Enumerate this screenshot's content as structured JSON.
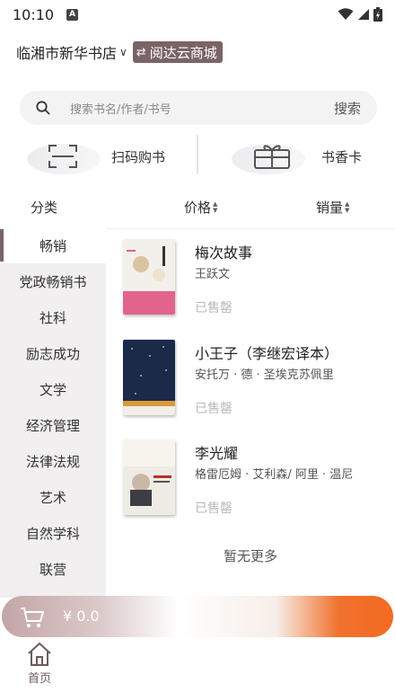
{
  "status_bar": {
    "time": "10:10",
    "notification_badge": "A"
  },
  "header": {
    "store_name": "临湘市新华书店",
    "switch_label": "阅达云商城"
  },
  "search": {
    "placeholder": "搜索书名/作者/书号",
    "button_label": "搜索"
  },
  "shortcuts": {
    "scan_label": "扫码购书",
    "card_label": "书香卡"
  },
  "sort_bar": {
    "category_label": "分类",
    "price_label": "价格",
    "sales_label": "销量"
  },
  "sidebar": {
    "items": [
      {
        "label": "畅销",
        "active": true
      },
      {
        "label": "党政畅销书",
        "active": false
      },
      {
        "label": "社科",
        "active": false
      },
      {
        "label": "励志成功",
        "active": false
      },
      {
        "label": "文学",
        "active": false
      },
      {
        "label": "经济管理",
        "active": false
      },
      {
        "label": "法律法规",
        "active": false
      },
      {
        "label": "艺术",
        "active": false
      },
      {
        "label": "自然学科",
        "active": false
      },
      {
        "label": "联营",
        "active": false
      }
    ]
  },
  "books": [
    {
      "title": "梅次故事",
      "author": "王跃文",
      "status": "已售罄",
      "cover_color": "#f3f0ec"
    },
    {
      "title": "小王子（李继宏译本）",
      "author": "安托万 · 德 · 圣埃克苏佩里",
      "status": "已售罄",
      "cover_color": "#1c2a4a"
    },
    {
      "title": "李光耀",
      "author": "格雷厄姆 · 艾利森/ 阿里 · 温尼",
      "status": "已售罄",
      "cover_color": "#efece6"
    }
  ],
  "list_footer": "暂无更多",
  "cart": {
    "total": "¥ 0.0"
  },
  "tabbar": {
    "home_label": "首页"
  },
  "colors": {
    "accent": "#7a6466",
    "sidebar_bg": "#f1eff0",
    "checkout_orange": "#f46a22"
  }
}
